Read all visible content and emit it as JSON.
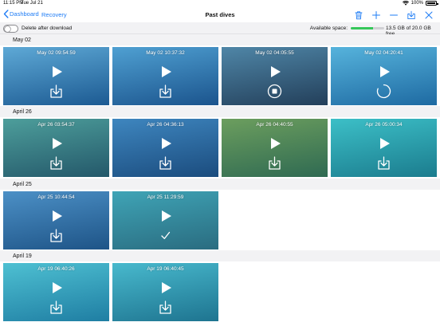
{
  "status_bar": {
    "time": "11:15 PM",
    "date": "Tue Jul 21",
    "battery": "100%",
    "battery_level": 1.0
  },
  "nav": {
    "back_label": "Dashboard",
    "breadcrumb": "Recovery",
    "title": "Past dives",
    "actions": [
      "trash-icon",
      "add-icon",
      "minus-icon",
      "download-all-icon",
      "close-icon"
    ]
  },
  "toolbar": {
    "toggle_label": "Delete after download",
    "toggle_on": false,
    "space_label": "Available space:",
    "space_text": "13.5 GB of 20.0 GB free",
    "space_fraction": 0.675
  },
  "sections": [
    {
      "header": "May 02",
      "tiles": [
        {
          "timestamp": "May 02 09:54:59",
          "state": "download",
          "gradient": [
            "#5ea9d6",
            "#1c5a92"
          ]
        },
        {
          "timestamp": "May 02 10:37:32",
          "state": "download",
          "gradient": [
            "#4fa0d2",
            "#1b548d"
          ]
        },
        {
          "timestamp": "May 02 04:05:55",
          "state": "stop",
          "gradient": [
            "#4f86a7",
            "#233f5a"
          ]
        },
        {
          "timestamp": "May 02 04:20:41",
          "state": "loading",
          "gradient": [
            "#56b3dc",
            "#1e6aa2"
          ]
        }
      ]
    },
    {
      "header": "April 26",
      "tiles": [
        {
          "timestamp": "Apr 26 03:54:37",
          "state": "download",
          "gradient": [
            "#4d9e9b",
            "#24586a"
          ]
        },
        {
          "timestamp": "Apr 26 04:36:13",
          "state": "download",
          "gradient": [
            "#3e86bf",
            "#1b4c7e"
          ]
        },
        {
          "timestamp": "Apr 26 04:40:55",
          "state": "download",
          "gradient": [
            "#6c9e5e",
            "#2f6a52"
          ]
        },
        {
          "timestamp": "Apr 26 05:00:34",
          "state": "download",
          "gradient": [
            "#3cbfc7",
            "#1b7c8e"
          ]
        }
      ]
    },
    {
      "header": "April 25",
      "tiles": [
        {
          "timestamp": "Apr 25 10:44:54",
          "state": "download",
          "gradient": [
            "#4c90c6",
            "#1e5487"
          ]
        },
        {
          "timestamp": "Apr 25 11:29:59",
          "state": "done",
          "gradient": [
            "#3fa4b6",
            "#2a6c80"
          ]
        }
      ]
    },
    {
      "header": "April 19",
      "tiles": [
        {
          "timestamp": "Apr 19 06:40:26",
          "state": "download",
          "gradient": [
            "#4ec0d2",
            "#1f7ea3"
          ]
        },
        {
          "timestamp": "Apr 19 06:40:45",
          "state": "download",
          "gradient": [
            "#48b9cd",
            "#1e7490"
          ]
        }
      ]
    }
  ]
}
